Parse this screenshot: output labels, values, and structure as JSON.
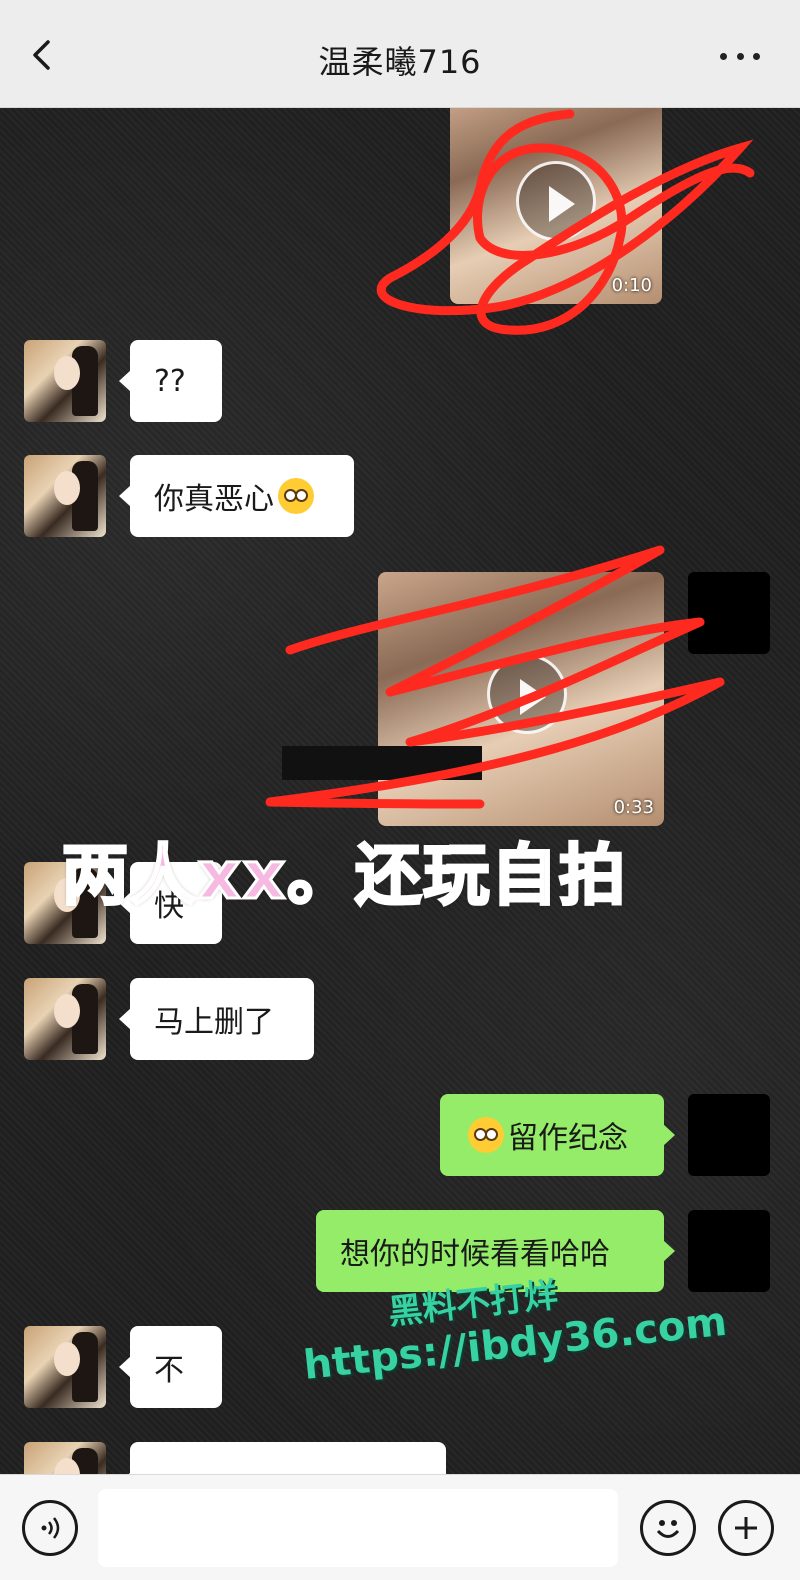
{
  "header": {
    "title": "温柔曦716"
  },
  "messages": {
    "video1_duration": "0:10",
    "msg1": "??",
    "msg2": "你真恶心",
    "video2_duration": "0:33",
    "msg3": "快",
    "msg4": "马上删了",
    "msg5": "留作纪念",
    "msg6": "想你的时候看看哈哈",
    "msg7": "不"
  },
  "overlay": {
    "caption": "两人xx。还玩自拍"
  },
  "watermark": {
    "line1": "黑料不打烊",
    "line2": "https://ibdy36.com"
  },
  "input": {
    "value": ""
  },
  "colors": {
    "header_bg": "#ededed",
    "self_bubble": "#95ec69",
    "other_bubble": "#ffffff",
    "scribble": "#ff2a1f"
  }
}
